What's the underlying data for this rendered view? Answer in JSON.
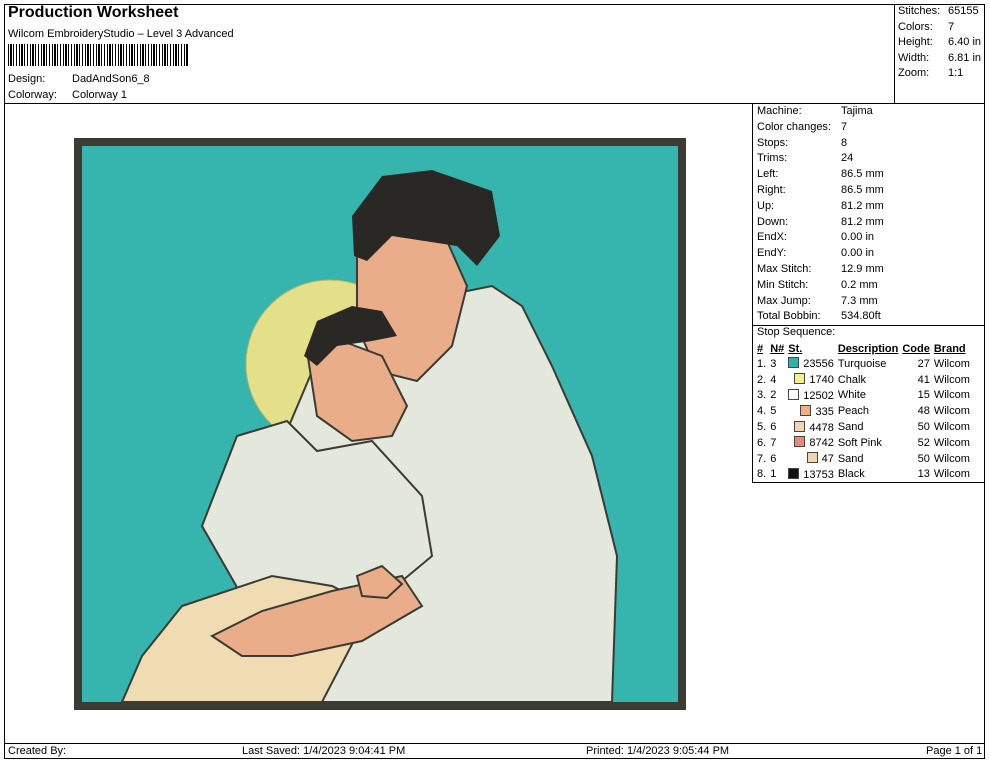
{
  "header": {
    "title": "Production Worksheet",
    "subtitle": "Wilcom EmbroideryStudio – Level 3 Advanced",
    "design_label": "Design:",
    "design_value": "DadAndSon6_8",
    "colorway_label": "Colorway:",
    "colorway_value": "Colorway 1"
  },
  "stats": {
    "stitches_label": "Stitches:",
    "stitches": "65155",
    "colors_label": "Colors:",
    "colors": "7",
    "height_label": "Height:",
    "height": "6.40 in",
    "width_label": "Width:",
    "width": "6.81 in",
    "zoom_label": "Zoom:",
    "zoom": "1:1"
  },
  "machine_info": [
    {
      "label": "Machine:",
      "value": "Tajima"
    },
    {
      "label": "Color changes:",
      "value": "7"
    },
    {
      "label": "Stops:",
      "value": "8"
    },
    {
      "label": "Trims:",
      "value": "24"
    },
    {
      "label": "Left:",
      "value": "86.5 mm"
    },
    {
      "label": "Right:",
      "value": "86.5 mm"
    },
    {
      "label": "Up:",
      "value": "81.2 mm"
    },
    {
      "label": "Down:",
      "value": "81.2 mm"
    },
    {
      "label": "EndX:",
      "value": "0.00 in"
    },
    {
      "label": "EndY:",
      "value": "0.00 in"
    },
    {
      "label": "Max Stitch:",
      "value": "12.9 mm"
    },
    {
      "label": "Min Stitch:",
      "value": "0.2 mm"
    },
    {
      "label": "Max Jump:",
      "value": "7.3 mm"
    },
    {
      "label": "Total Bobbin:",
      "value": "534.80ft"
    }
  ],
  "stop_sequence": {
    "title": "Stop Sequence:",
    "columns": [
      "#",
      "N#",
      "St.",
      "Description",
      "Code",
      "Brand"
    ],
    "rows": [
      {
        "num": "1.",
        "n": "3",
        "color": "#2ab3b0",
        "st": "23556",
        "desc": "Turquoise",
        "code": "27",
        "brand": "Wilcom"
      },
      {
        "num": "2.",
        "n": "4",
        "color": "#f3f08a",
        "st": "1740",
        "desc": "Chalk",
        "code": "41",
        "brand": "Wilcom"
      },
      {
        "num": "3.",
        "n": "2",
        "color": "#ffffff",
        "st": "12502",
        "desc": "White",
        "code": "15",
        "brand": "Wilcom"
      },
      {
        "num": "4.",
        "n": "5",
        "color": "#f2b07e",
        "st": "335",
        "desc": "Peach",
        "code": "48",
        "brand": "Wilcom"
      },
      {
        "num": "5.",
        "n": "6",
        "color": "#f3d3b0",
        "st": "4478",
        "desc": "Sand",
        "code": "50",
        "brand": "Wilcom"
      },
      {
        "num": "6.",
        "n": "7",
        "color": "#ea8a6e",
        "st": "8742",
        "desc": "Soft Pink",
        "code": "52",
        "brand": "Wilcom"
      },
      {
        "num": "7.",
        "n": "6",
        "color": "#f3d3b0",
        "st": "47",
        "desc": "Sand",
        "code": "50",
        "brand": "Wilcom"
      },
      {
        "num": "8.",
        "n": "1",
        "color": "#111111",
        "st": "13753",
        "desc": "Black",
        "code": "13",
        "brand": "Wilcom"
      }
    ]
  },
  "footer": {
    "created_by": "Created By:",
    "last_saved": "Last Saved: 1/4/2023 9:04:41 PM",
    "printed": "Printed: 1/4/2023 9:05:44 PM",
    "page": "Page 1 of 1"
  },
  "design_colors": {
    "background": "#36b5ae",
    "border": "#3b3a33",
    "sun": "#e4e08a",
    "skin": "#e9ad8a",
    "shirt": "#e4e8dc",
    "pants": "#efdcb3",
    "hair": "#2a2824"
  }
}
